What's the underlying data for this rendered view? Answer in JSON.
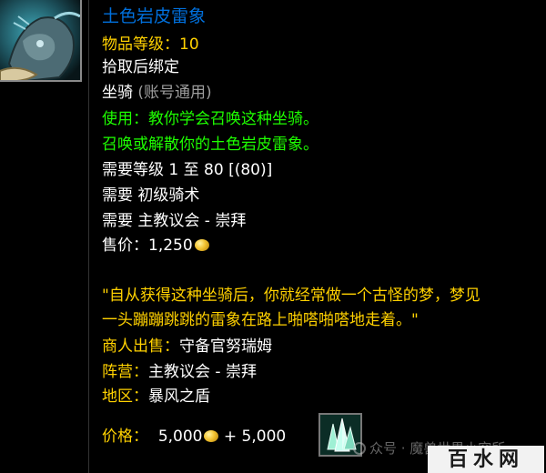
{
  "item": {
    "icon": "rock-elekk-mount-icon",
    "name": "土色岩皮雷象",
    "name_color": "#0070dd",
    "item_level_label": "物品等级：",
    "item_level_value": "10",
    "bind": "拾取后绑定",
    "type": "坐骑",
    "type_note": "(账号通用)",
    "use_line1": "使用：教你学会召唤这种坐骑。",
    "use_line2": "召唤或解散你的土色岩皮雷象。",
    "req_level": "需要等级 1 至 80 [(80)]",
    "req_skill": "需要 初级骑术",
    "req_rep": "需要 主教议会 - 崇拜",
    "sell_label": "售价：",
    "sell_value": "1,250",
    "flavor_line1": "\"自从获得这种坐骑后，你就经常做一个古怪的梦，梦见",
    "flavor_line2": "一头蹦蹦跳跳的雷象在路上啪嗒啪嗒地走着。\"",
    "vendor_label": "商人出售：",
    "vendor_value": "守备官努瑞姆",
    "faction_label": "阵营：",
    "faction_value": "主教议会 - 崇拜",
    "zone_label": "地区：",
    "zone_value": "暴风之盾",
    "price_label": "价格：",
    "price_gold": "5,000",
    "price_plus": "+ 5,000",
    "reagent_icon": "crystal-reagent-icon"
  },
  "watermark": {
    "text": "众号 · 魔兽世界小究所",
    "site": "百水网"
  },
  "colors": {
    "yellow": "#ffd100",
    "green": "#1eff00",
    "white": "#ffffff",
    "grey": "#9d9d9d",
    "gold_coin": "#f2c230"
  }
}
